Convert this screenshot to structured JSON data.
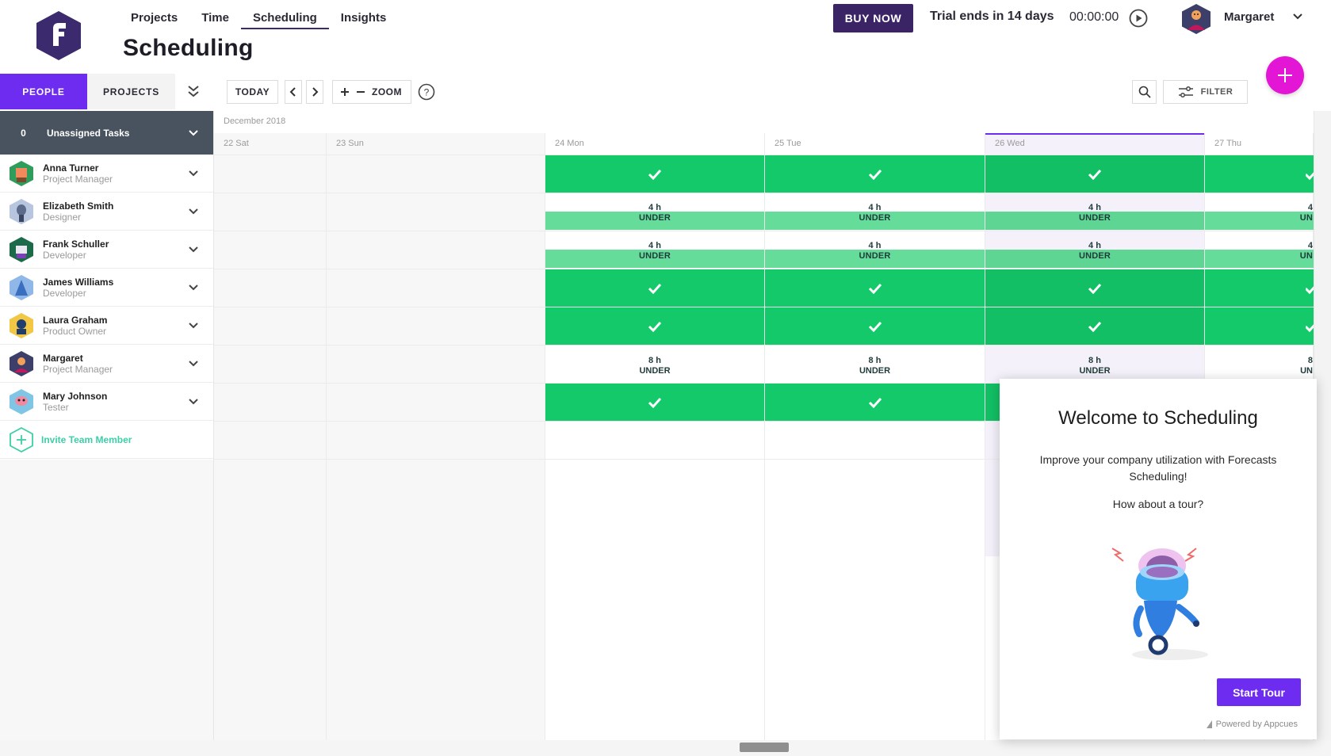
{
  "nav": {
    "items": [
      "Projects",
      "Time",
      "Scheduling",
      "Insights"
    ],
    "active": "Scheduling"
  },
  "page": {
    "title": "Scheduling"
  },
  "topbar": {
    "buy_now": "BUY NOW",
    "trial": "Trial ends in 14 days",
    "timer": "00:00:00",
    "user_name": "Margaret"
  },
  "toolbar": {
    "tab_people": "PEOPLE",
    "tab_projects": "PROJECTS",
    "today": "TODAY",
    "zoom": "ZOOM",
    "filter": "FILTER"
  },
  "unassigned": {
    "count": "0",
    "label": "Unassigned Tasks"
  },
  "people": [
    {
      "name": "Anna Turner",
      "role": "Project Manager"
    },
    {
      "name": "Elizabeth Smith",
      "role": "Designer"
    },
    {
      "name": "Frank Schuller",
      "role": "Developer"
    },
    {
      "name": "James Williams",
      "role": "Developer"
    },
    {
      "name": "Laura Graham",
      "role": "Product Owner"
    },
    {
      "name": "Margaret",
      "role": "Project Manager"
    },
    {
      "name": "Mary Johnson",
      "role": "Tester"
    }
  ],
  "invite": {
    "label": "Invite Team Member"
  },
  "calendar": {
    "month": "December 2018",
    "days": [
      "22 Sat",
      "23 Sun",
      "24 Mon",
      "25 Tue",
      "26 Wed",
      "27 Thu"
    ],
    "today": "26 Wed",
    "status_under": "UNDER",
    "status_under_cut": "UN",
    "hours_4": "4 h",
    "hours_8": "8 h",
    "hours_4_cut": "4",
    "hours_8_cut": "8"
  },
  "modal": {
    "title": "Welcome to Scheduling",
    "body": "Improve your company utilization with Forecasts Scheduling!",
    "question": "How about a tour?",
    "start_tour": "Start Tour",
    "powered_by": "Powered by Appcues"
  },
  "colors": {
    "accent": "#6e2cf0",
    "buy_now": "#3a2466",
    "fab": "#e416d6",
    "available": "#14c96a",
    "under": "#66dc9a",
    "invite": "#3ccfa8",
    "unassigned_bg": "#48535f"
  }
}
